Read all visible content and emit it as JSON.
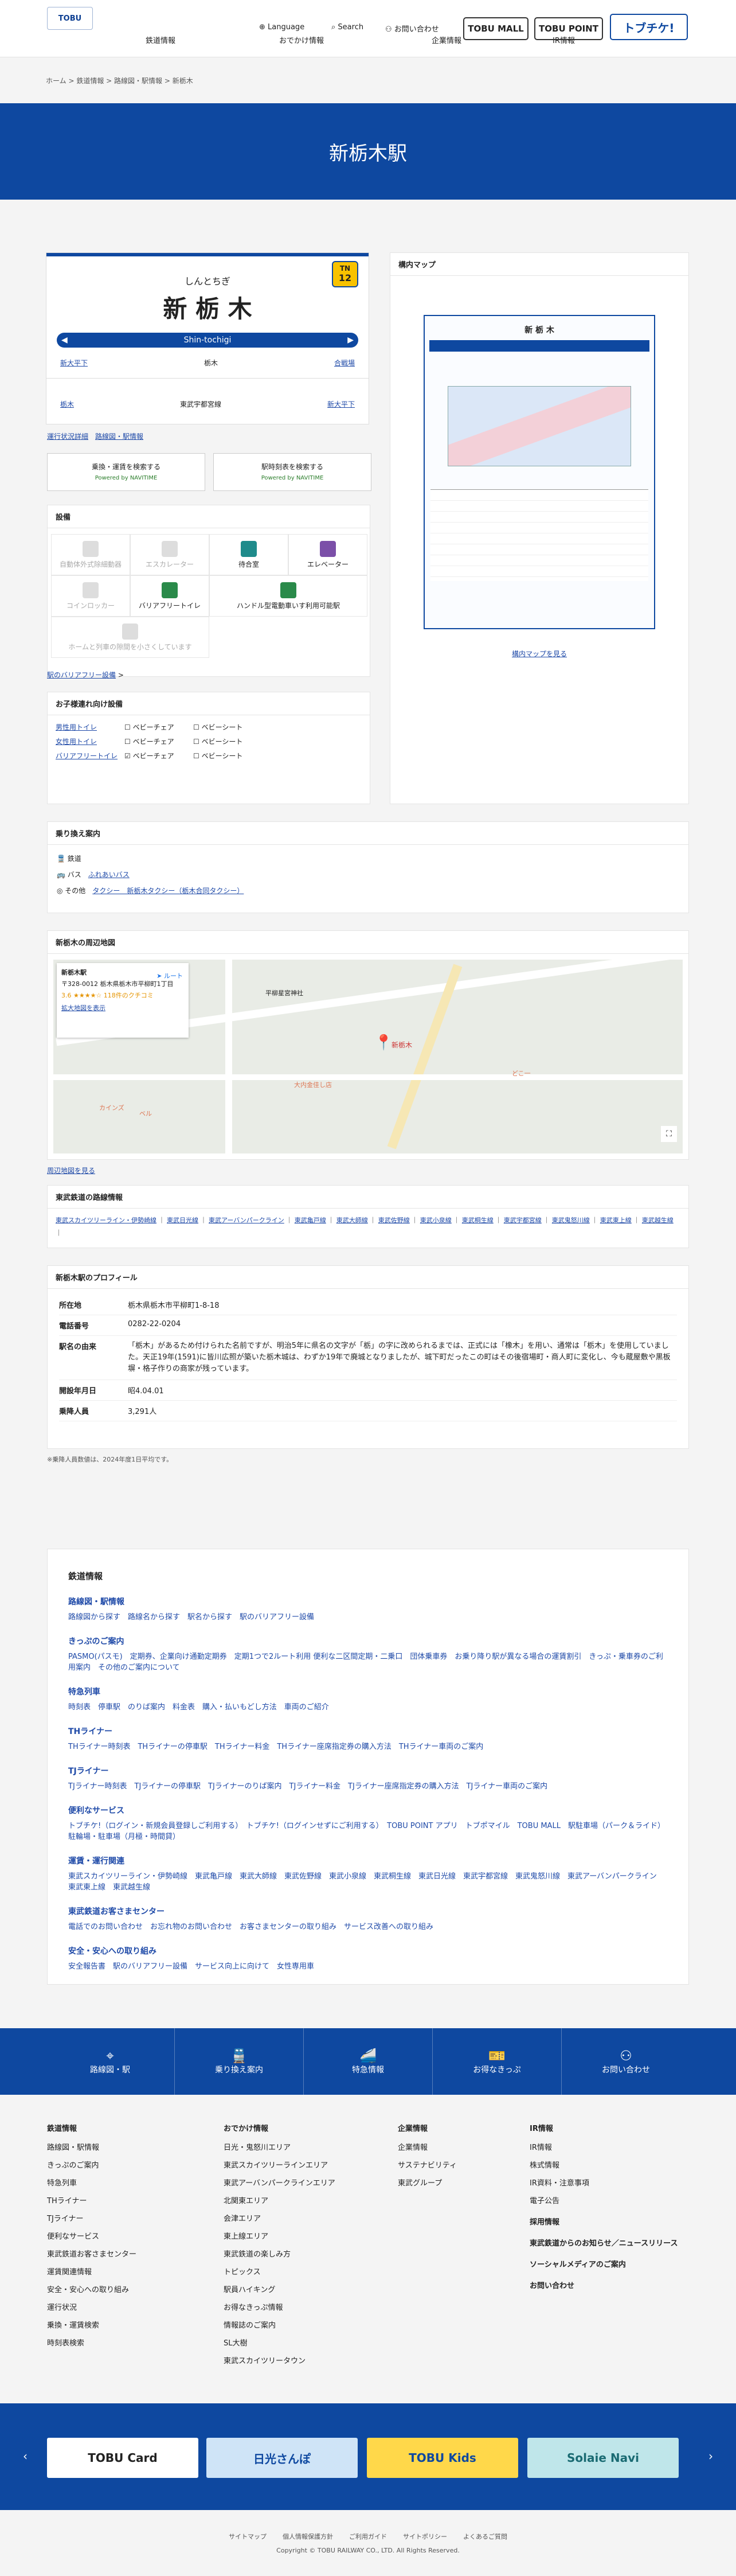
{
  "header": {
    "logo": "TOBU",
    "nav": [
      "鉄道情報",
      "おでかけ情報",
      "企業情報",
      "IR情報"
    ],
    "utility": [
      "Language",
      "Search",
      "お問い合わせ"
    ],
    "pills": [
      "TOBU MALL",
      "TOBU POINT",
      "トブチケ!"
    ]
  },
  "breadcrumb": [
    "ホーム",
    "鉄道情報",
    "路線図・駅情報",
    "新栃木"
  ],
  "title": "新栃木駅",
  "sign": {
    "kana": "しんとちぎ",
    "kanji": "新 栃 木",
    "roman": "Shin-tochigi",
    "badge_line": "TN",
    "badge_num": "12",
    "prev1": "新大平下",
    "next1": "合戦場",
    "prev2": "栃木",
    "next2": "東武宇都宮線"
  },
  "links_top": [
    "運行状況詳細",
    "路線図・駅情報"
  ],
  "search_buttons": [
    {
      "l1": "乗換・運賃を検索する",
      "l2": "Powered by NAVITIME"
    },
    {
      "l1": "駅時刻表を検索する",
      "l2": "Powered by NAVITIME"
    }
  ],
  "facilities": {
    "title": "設備",
    "items": [
      "自動体外式除細動器",
      "エスカレーター",
      "待合室",
      "エレベーター",
      "コインロッカー",
      "バリアフリートイレ",
      "ハンドル型電動車いす利用可能駅",
      "ホームと列車の隙間を小さくしています"
    ],
    "link": "駅のバリアフリー設備"
  },
  "kids": {
    "title": "お子様連れ向け設備",
    "rows": [
      {
        "name": "男性用トイレ",
        "a": "ベビーチェア",
        "b": "ベビーシート"
      },
      {
        "name": "女性用トイレ",
        "a": "ベビーチェア",
        "b": "ベビーシート"
      },
      {
        "name": "バリアフリートイレ",
        "a": "ベビーチェア",
        "b": "ベビーシート"
      }
    ]
  },
  "map": {
    "title": "構内マップ",
    "link": "構内マップを見る"
  },
  "transfer": {
    "title": "乗り換え案内",
    "rows": [
      {
        "k": "鉄道",
        "v": ""
      },
      {
        "k": "バス",
        "v": "ふれあいバス"
      },
      {
        "k": "その他",
        "v": "タクシー　新栃木タクシー（栃木合同タクシー）"
      }
    ]
  },
  "area": {
    "title": "新栃木の周辺地図",
    "card_title": "新栃木駅",
    "card_addr": "〒328-0012 栃木県栃木市平柳町1丁目",
    "rating": "3.6 ★★★★☆ 118件のクチコミ",
    "route": "ルート",
    "enlarge": "拡大地図を表示",
    "link": "周辺地図を見る",
    "labels": [
      "新栃木",
      "平柳星宮神社",
      "どこ一",
      "ベル",
      "カインズ",
      "大内金佳し店"
    ]
  },
  "lines": {
    "title": "東武鉄道の路線情報",
    "items": [
      "東武スカイツリーライン・伊勢崎線",
      "東武日光線",
      "東武アーバンパークライン",
      "東武亀戸線",
      "東武大師線",
      "東武佐野線",
      "東武小泉線",
      "東武桐生線",
      "東武宇都宮線",
      "東武鬼怒川線",
      "東武東上線",
      "東武越生線"
    ]
  },
  "profile": {
    "title": "新栃木駅のプロフィール",
    "rows": [
      {
        "k": "所在地",
        "v": "栃木県栃木市平柳町1-8-18"
      },
      {
        "k": "電話番号",
        "v": "0282-22-0204"
      },
      {
        "k": "駅名の由来",
        "v": "「栃木」があるため付けられた名前ですが、明治5年に県名の文字が「栃」の字に改められるまでは、正式には「橡木」を用い、通常は「栃木」を使用していました。天正19年(1591)に皆川広照が築いた栃木城は、わずか19年で廃城となりましたが、城下町だったこの町はその後宿場町・商人町に変化し、今も蔵屋敷や黒板塀・格子作りの商家が残っています。"
      },
      {
        "k": "開設年月日",
        "v": "昭4.04.01"
      },
      {
        "k": "乗降人員",
        "v": "3,291人"
      }
    ],
    "note": "※乗降人員数値は、2024年度1日平均です。"
  },
  "railinfo": {
    "title": "鉄道情報",
    "sections": [
      {
        "h": "路線図・駅情報",
        "t": "路線図から探す　路線名から探す　駅名から探す　駅のバリアフリー設備"
      },
      {
        "h": "きっぷのご案内",
        "t": "PASMO(パスモ)　定期券、企業向け通勤定期券　定期1つで2ルート利用 便利な二区間定期・二乗口　団体乗車券　お乗り降り駅が異なる場合の運賃割引　きっぷ・乗車券のご利用案内　その他のご案内について"
      },
      {
        "h": "特急列車",
        "t": "時刻表　停車駅　のりば案内　料金表　購入・払いもどし方法　車両のご紹介"
      },
      {
        "h": "THライナー",
        "t": "THライナー時刻表　THライナーの停車駅　THライナー料金　THライナー座席指定券の購入方法　THライナー車両のご案内"
      },
      {
        "h": "TJライナー",
        "t": "TJライナー時刻表　TJライナーの停車駅　TJライナーのりば案内　TJライナー料金　TJライナー座席指定券の購入方法　TJライナー車両のご案内"
      },
      {
        "h": "便利なサービス",
        "t": "トブチケ!（ログイン・新規会員登録しご利用する）　トブチケ!（ログインせずにご利用する）　TOBU POINT アプリ　トブポマイル　TOBU MALL　駅駐車場（パーク＆ライド）　駐輪場・駐車場（月極・時間貸）"
      },
      {
        "h": "運賃・運行関連",
        "t": "東武スカイツリーライン・伊勢崎線　東武亀戸線　東武大師線　東武佐野線　東武小泉線　東武桐生線　東武日光線　東武宇都宮線　東武鬼怒川線　東武アーバンパークライン　東武東上線　東武越生線"
      },
      {
        "h": "東武鉄道お客さまセンター",
        "t": "電話でのお問い合わせ　お忘れ物のお問い合わせ　お客さまセンターの取り組み　サービス改善への取り組み"
      },
      {
        "h": "安全・安心への取り組み",
        "t": "安全報告書　駅のバリアフリー設備　サービス向上に向けて　女性専用車"
      }
    ]
  },
  "tiles": [
    "路線図・駅",
    "乗り換え案内",
    "特急情報",
    "お得なきっぷ",
    "お問い合わせ"
  ],
  "footer": {
    "cols": [
      {
        "h": "鉄道情報",
        "items": [
          "路線図・駅情報",
          "きっぷのご案内",
          "特急列車",
          "THライナー",
          "TJライナー",
          "便利なサービス",
          "東武鉄道お客さまセンター",
          "運賃関連情報",
          "安全・安心への取り組み",
          "運行状況",
          "乗換・運賃検索",
          "時刻表検索"
        ]
      },
      {
        "h": "おでかけ情報",
        "items": [
          "日光・鬼怒川エリア",
          "東武スカイツリーラインエリア",
          "東武アーバンパークラインエリア",
          "北関東エリア",
          "会津エリア",
          "東上線エリア",
          "東武鉄道の楽しみ方",
          "トピックス",
          "駅員ハイキング",
          "お得なきっぷ情報",
          "情報誌のご案内",
          "SL大樹",
          "東武スカイツリータウン"
        ]
      },
      {
        "h": "企業情報",
        "items": [
          "企業情報",
          "サステナビリティ",
          "東武グループ"
        ]
      },
      {
        "h": "IR情報",
        "items": [
          "IR情報",
          "株式情報",
          "IR資料・注意事項",
          "電子公告"
        ],
        "extra": [
          "採用情報",
          "東武鉄道からのお知らせ／ニュースリリース",
          "ソーシャルメディアのご案内",
          "お問い合わせ"
        ]
      }
    ]
  },
  "banners": [
    "TOBU Card",
    "日光さんぽ",
    "TOBU Kids",
    "Solaie Navi"
  ],
  "bottom": {
    "links": [
      "サイトマップ",
      "個人情報保護方針",
      "ご利用ガイド",
      "サイトポリシー",
      "よくあるご質問"
    ],
    "copy": "Copyright © TOBU RAILWAY CO., LTD. All Rights Reserved."
  }
}
